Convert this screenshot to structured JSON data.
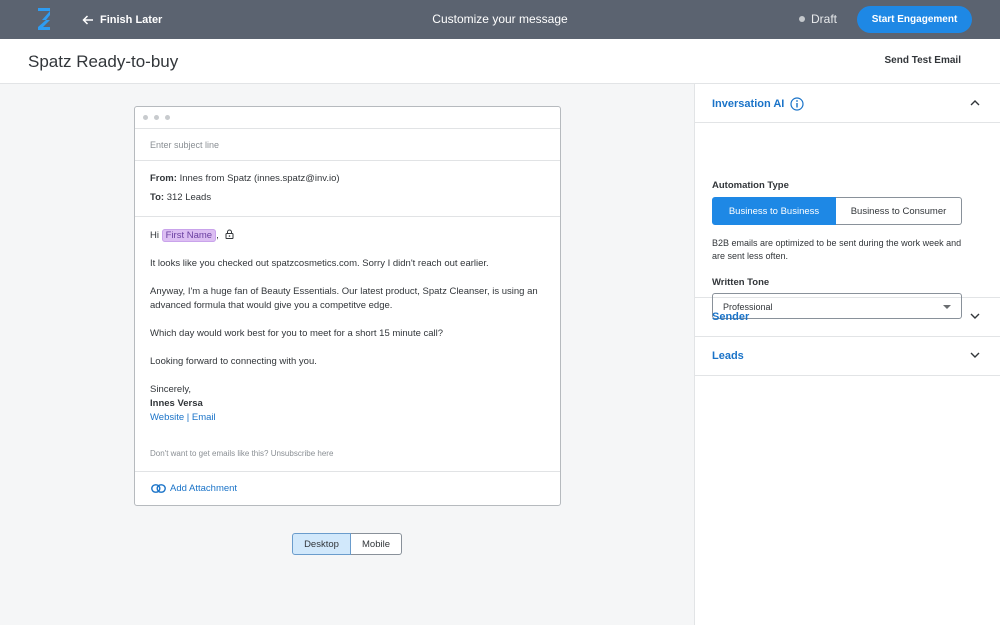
{
  "topbar": {
    "back_label": "Finish Later",
    "title": "Customize your message",
    "status": "Draft",
    "start_label": "Start Engagement"
  },
  "page": {
    "title": "Spatz Ready-to-buy",
    "send_test_label": "Send Test Email"
  },
  "email": {
    "subject_placeholder": "Enter subject line",
    "from_label": "From:",
    "from_value": "Innes from Spatz (innes.spatz@inv.io)",
    "to_label": "To:",
    "to_value": "312 Leads",
    "greeting": "Hi",
    "first_name_token": "First Name",
    "greeting_suffix": ",",
    "paragraph_1": "It looks like you checked out spatzcosmetics.com. Sorry I didn't reach out earlier.",
    "paragraph_2": "Anyway, I'm a huge fan of Beauty Essentials. Our latest product, Spatz Cleanser, is using an advanced formula that would give you a competitve edge.",
    "paragraph_3": "Which day would work best for you to meet for a short 15 minute call?",
    "paragraph_4": "Looking forward to connecting with you.",
    "signoff": "Sincerely,",
    "signature_name": "Innes Versa",
    "link_website": "Website",
    "link_separator": "|",
    "link_email": "Email",
    "unsubscribe": "Don't want to get emails like this? Unsubscribe here",
    "attach_label": "Add Attachment"
  },
  "view_toggle": {
    "desktop_label": "Desktop",
    "mobile_label": "Mobile",
    "selected": "Desktop"
  },
  "panel": {
    "ai_title": "Inversation AI",
    "automation_label": "Automation Type",
    "b2b_label": "Business to Business",
    "b2c_label": "Business to Consumer",
    "hint": "B2B emails are optimized to be sent during the work week and are sent less often.",
    "tone_label": "Written Tone",
    "tone_value": "Professional",
    "sender_title": "Sender",
    "leads_title": "Leads"
  },
  "colors": {
    "topbar": "#5b6370",
    "accent": "#1e88e5",
    "link": "#1a73c8",
    "token": "#dcbef2"
  }
}
